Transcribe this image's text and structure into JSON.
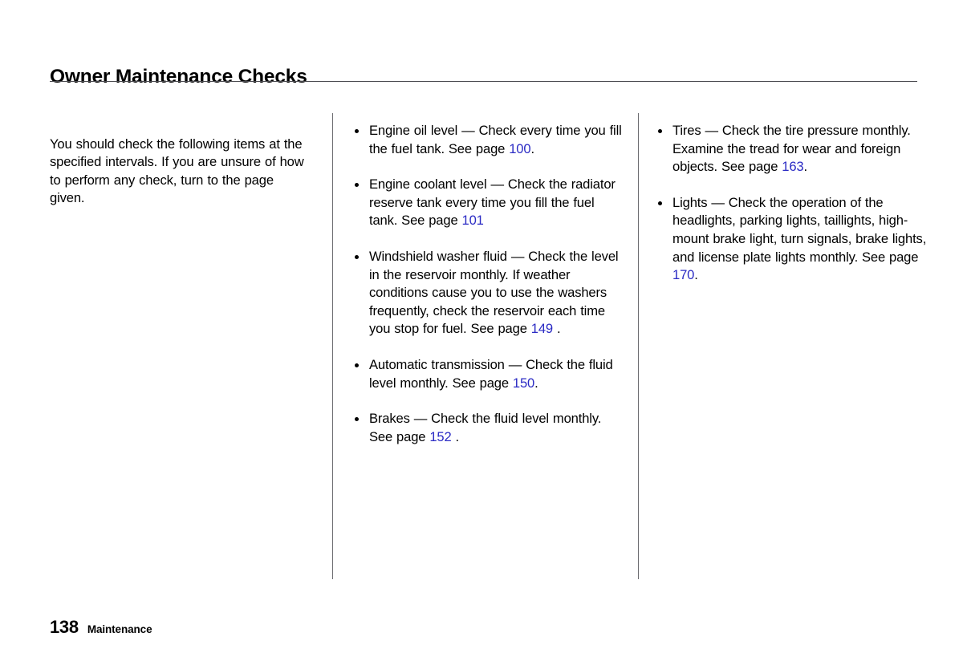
{
  "document": {
    "title": "Owner Maintenance Checks"
  },
  "intro": {
    "text": "You should check the following items at the specified intervals. If you are unsure of how to perform any check, turn to the page given."
  },
  "columns": {
    "middle": [
      {
        "id": "engine-oil-level",
        "before": "Engine oil level — Check every time you fill the fuel tank. See page ",
        "page_ref": "100",
        "after": "."
      },
      {
        "id": "engine-coolant-level",
        "before": "Engine coolant level — Check the radiator reserve tank every time you fill the fuel tank. See page ",
        "page_ref": "101",
        "after": ""
      },
      {
        "id": "windshield-washer-fluid",
        "before": "Windshield washer fluid — Check the level in the reservoir monthly. If weather conditions cause you to use the washers frequently, check the reservoir each time you stop for fuel. See page ",
        "page_ref": "149",
        "after": " ."
      },
      {
        "id": "automatic-transmission",
        "before": "Automatic transmission — Check the fluid level monthly. See page ",
        "page_ref": "150",
        "after": "."
      },
      {
        "id": "brakes",
        "before": "Brakes — Check the fluid level monthly. See page ",
        "page_ref": "152",
        "after": " ."
      }
    ],
    "right": [
      {
        "id": "tires",
        "before": "Tires — Check the tire pressure monthly. Examine the tread for wear and foreign objects. See page ",
        "page_ref": "163",
        "after": "."
      },
      {
        "id": "lights",
        "before": "Lights — Check the operation of the headlights, parking lights, taillights, high-mount brake light, turn signals, brake lights, and license plate lights monthly. See page ",
        "page_ref": "170",
        "after": "."
      }
    ]
  },
  "footer": {
    "page_number": "138",
    "section": "Maintenance"
  },
  "colors": {
    "page_ref_blue": "#2b2bc4",
    "text_black": "#000000",
    "rule_gray": "#4a4a4f",
    "background": "#ffffff"
  }
}
